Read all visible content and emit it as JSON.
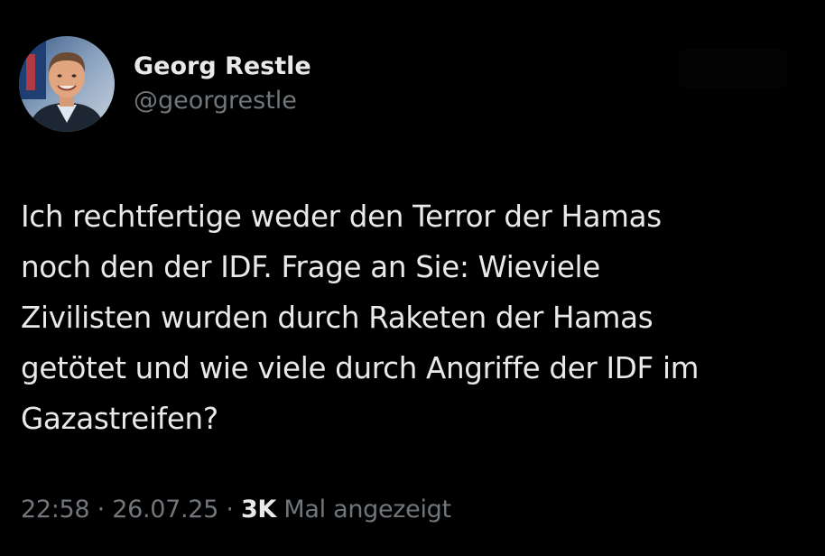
{
  "tweet": {
    "author": {
      "display_name": "Georg Restle",
      "handle": "@georgrestle",
      "avatar_icon": "profile-photo"
    },
    "text": "Ich rechtfertige weder den Terror der Hamas\nnoch den der IDF. Frage an Sie: Wieviele\nZivilisten wurden durch Raketen der Hamas\ngetötet und wie viele durch Angriffe der IDF im\nGazastreifen?",
    "meta": {
      "time": "22:58",
      "separator": "·",
      "date": "26.07.25",
      "views_count": "3K",
      "views_label": "Mal angezeigt"
    }
  },
  "colors": {
    "background": "#000000",
    "primary_text": "#e7e9ea",
    "secondary_text": "#71767b"
  }
}
